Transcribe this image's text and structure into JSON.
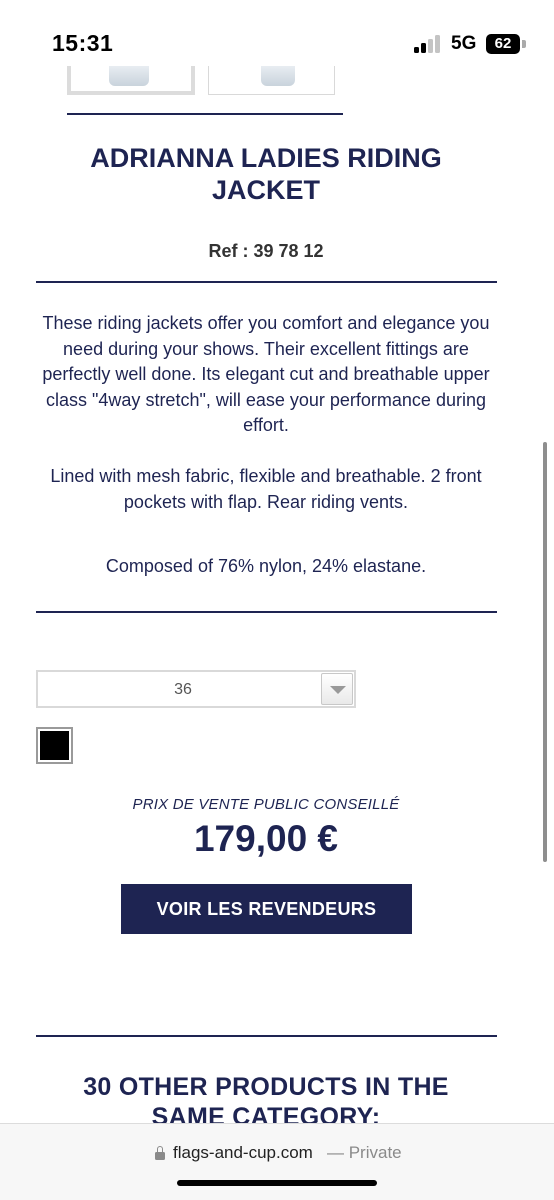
{
  "status": {
    "time": "15:31",
    "network": "5G",
    "battery": "62"
  },
  "product": {
    "title": "ADRIANNA LADIES RIDING JACKET",
    "ref": "Ref : 39 78 12",
    "description": [
      "These riding jackets offer you comfort and elegance you need during your shows. Their excellent fittings are perfectly well done. Its elegant cut and breathable upper class \"4way stretch\", will ease your performance during effort.",
      "Lined with mesh fabric, flexible and breathable. 2 front pockets with flap. Rear riding vents.",
      "Composed of 76% nylon, 24% elastane."
    ],
    "size": {
      "selected": "36"
    },
    "color_swatch": "#000000",
    "price_label": "PRIX DE VENTE PUBLIC CONSEILLÉ",
    "price": "179,00 €",
    "dealers_button": "VOIR LES REVENDEURS"
  },
  "related": {
    "title": "30 OTHER PRODUCTS IN THE SAME CATEGORY:"
  },
  "browser": {
    "domain": "flags-and-cup.com",
    "mode": "— Private"
  },
  "colors": {
    "navy": "#1e2452"
  }
}
